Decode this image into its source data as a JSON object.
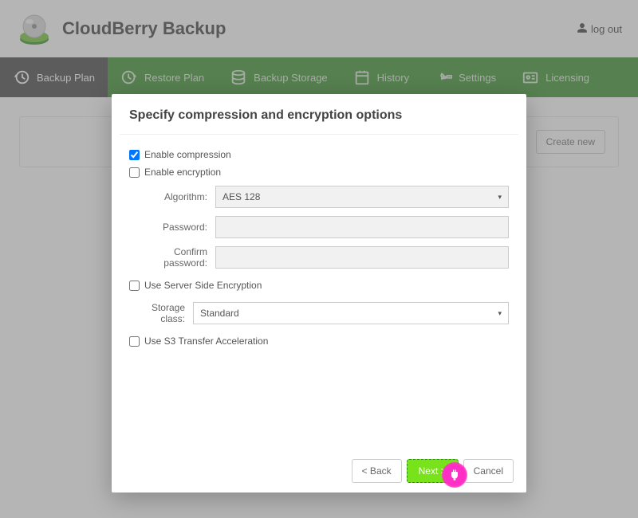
{
  "brand": {
    "title": "CloudBerry Backup"
  },
  "header": {
    "logout": "log out"
  },
  "nav": {
    "items": [
      {
        "label": "Backup Plan"
      },
      {
        "label": "Restore Plan"
      },
      {
        "label": "Backup Storage"
      },
      {
        "label": "History"
      },
      {
        "label": "Settings"
      },
      {
        "label": "Licensing"
      }
    ]
  },
  "page": {
    "create_new": "Create new"
  },
  "modal": {
    "title": "Specify compression and encryption options",
    "enable_compression_label": "Enable compression",
    "enable_compression_checked": true,
    "enable_encryption_label": "Enable encryption",
    "enable_encryption_checked": false,
    "algorithm_label": "Algorithm:",
    "algorithm_value": "AES 128",
    "password_label": "Password:",
    "password_value": "",
    "confirm_password_label": "Confirm password:",
    "confirm_password_value": "",
    "use_sse_label": "Use Server Side Encryption",
    "use_sse_checked": false,
    "storage_class_label": "Storage class:",
    "storage_class_value": "Standard",
    "use_s3ta_label": "Use S3 Transfer Acceleration",
    "use_s3ta_checked": false,
    "back": "< Back",
    "next": "Next >",
    "cancel": "Cancel"
  }
}
